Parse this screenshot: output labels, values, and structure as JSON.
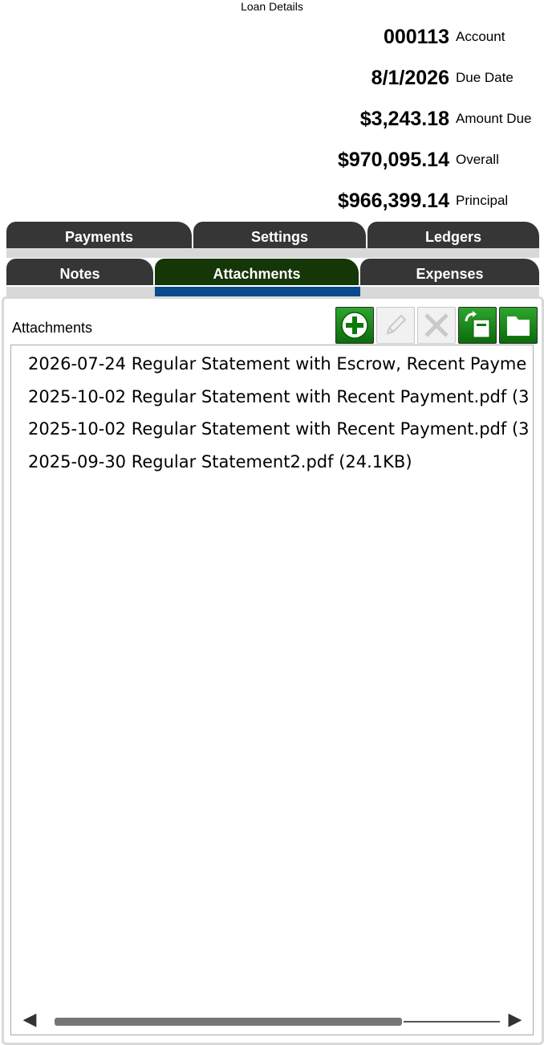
{
  "window": {
    "title": "Loan Details"
  },
  "summary": [
    {
      "value": "000113",
      "label": "Account"
    },
    {
      "value": "8/1/2026",
      "label": "Due Date"
    },
    {
      "value": "$3,243.18",
      "label": "Amount Due"
    },
    {
      "value": "$970,095.14",
      "label": "Overall"
    },
    {
      "value": "$966,399.14",
      "label": "Principal"
    }
  ],
  "tabs_row1": [
    {
      "label": "Payments"
    },
    {
      "label": "Settings"
    },
    {
      "label": "Ledgers"
    }
  ],
  "tabs_row2": [
    {
      "label": "Notes"
    },
    {
      "label": "Attachments",
      "active": true
    },
    {
      "label": "Expenses"
    }
  ],
  "attachments": {
    "label": "Attachments",
    "toolbar": [
      {
        "icon": "add-icon",
        "enabled": true
      },
      {
        "icon": "edit-pencil-icon",
        "enabled": false
      },
      {
        "icon": "delete-x-icon",
        "enabled": false
      },
      {
        "icon": "export-icon",
        "enabled": true
      },
      {
        "icon": "folder-icon",
        "enabled": true
      }
    ],
    "items": [
      "2026-07-24 Regular Statement with Escrow, Recent Payme",
      "2025-10-02 Regular Statement with Recent Payment.pdf (3",
      "2025-10-02 Regular Statement with Recent Payment.pdf (3",
      "2025-09-30 Regular Statement2.pdf (24.1KB)"
    ]
  },
  "colors": {
    "tab_bg": "#363636",
    "tab_active_bg": "#153606",
    "active_underline": "#0b4a8c",
    "button_green": "#1f8f1f"
  },
  "scroll": {
    "left_arrow": "◀",
    "right_arrow": "▶"
  }
}
